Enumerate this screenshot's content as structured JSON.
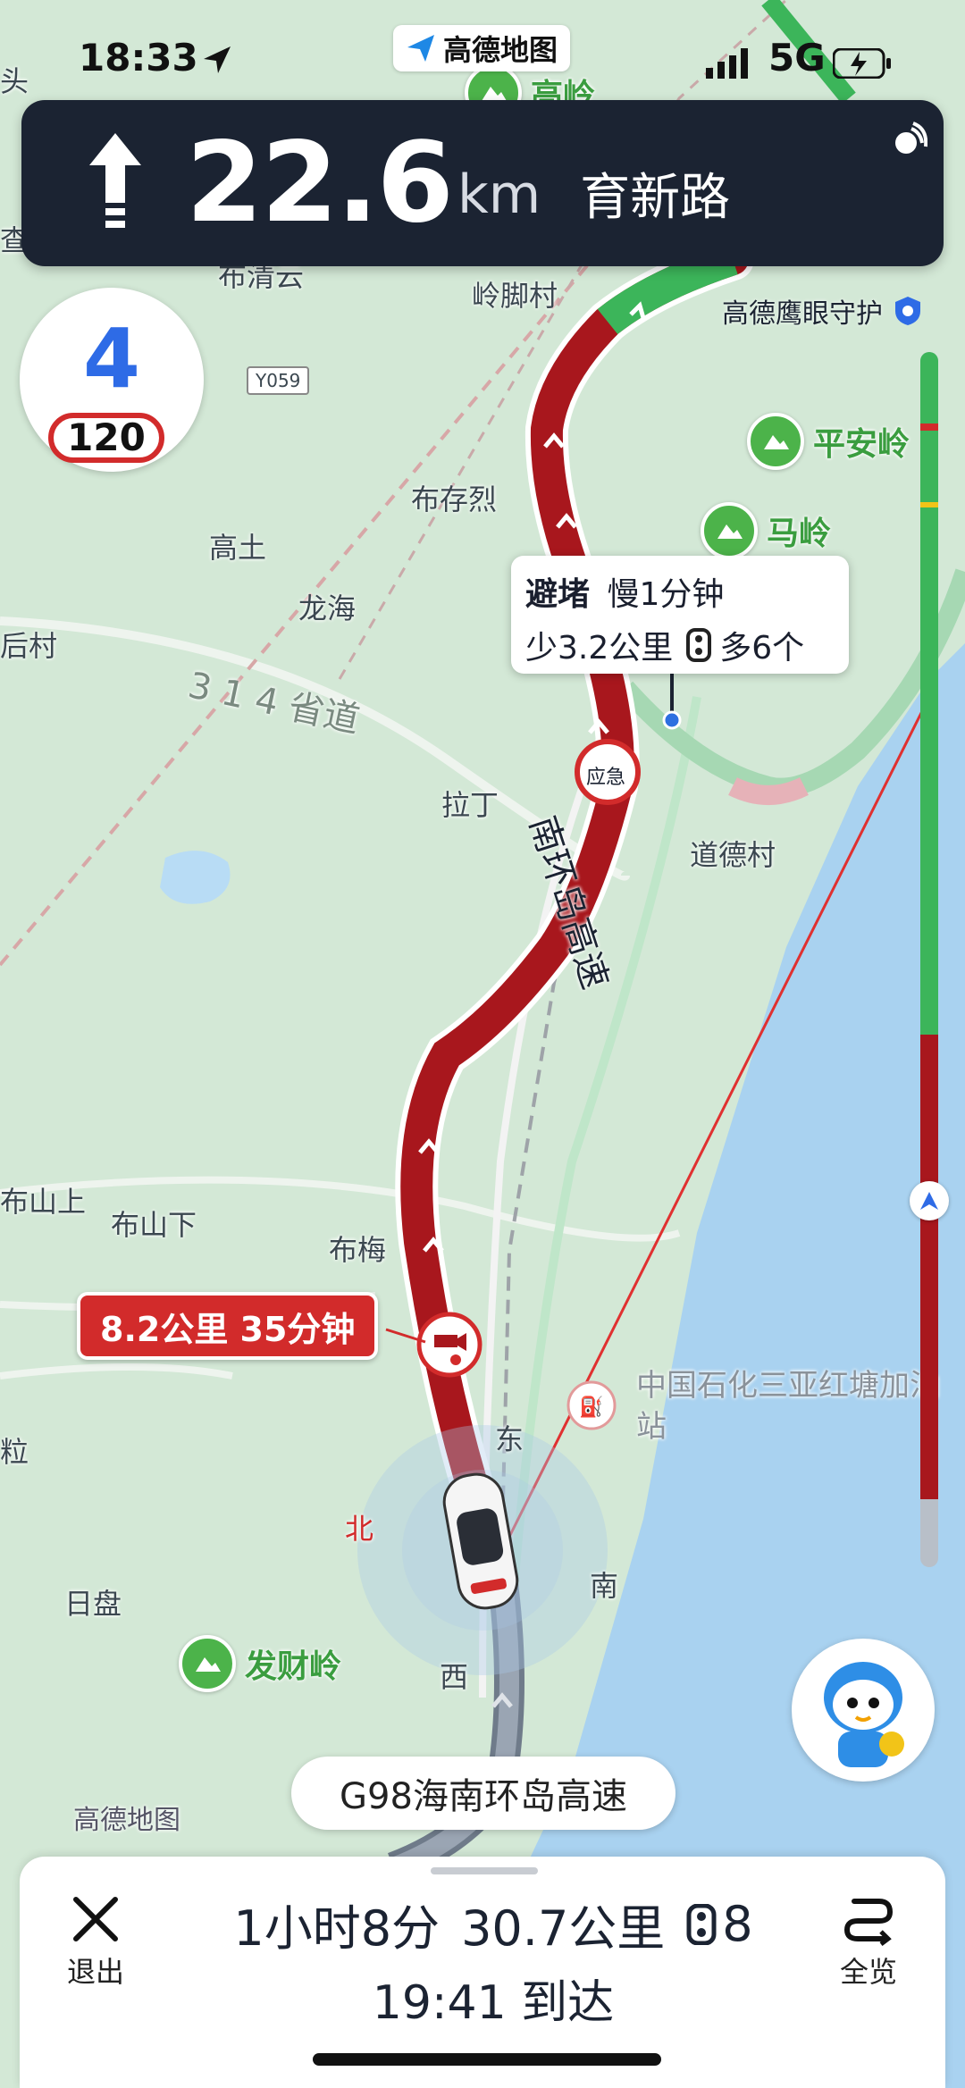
{
  "status_bar": {
    "time": "18:33",
    "network": "5G",
    "app_badge": "高德地图"
  },
  "banner": {
    "distance": "22.6",
    "unit": "km",
    "road": "育新路"
  },
  "lane": {
    "number": "4",
    "speed_limit": "120"
  },
  "eagle_eye": "高德鹰眼守护",
  "map_labels": {
    "gaoling": "高岭",
    "lingjiaocun": "岭脚村",
    "buqingyun": "布清云",
    "y059": "Y059",
    "bucunlie": "布存烈",
    "gaotu": "高土",
    "longhai": "龙海",
    "houcun": "后村",
    "sheng314": "3 1 4 省道",
    "lading": "拉丁",
    "daodecun": "道德村",
    "highway": "南环岛高速",
    "bushanshang": "布山上",
    "bushanxia": "布山下",
    "bumei": "布梅",
    "rili": "日盘",
    "dong": "东",
    "nan": "南",
    "xi": "西",
    "bei": "北",
    "fali": "粒",
    "tou": "头",
    "cha": "查",
    "gas_station": "中国石化三亚红塘加油站",
    "yingji": "应急",
    "brand_watermark": "高德地图",
    "hou": "后"
  },
  "pois": {
    "pinganling": "平安岭",
    "maling": "马岭",
    "facailing": "发财岭"
  },
  "tooltip": {
    "title": "避堵",
    "slower": "慢1分钟",
    "shorter": "少3.2公里",
    "more_lights": "多6个"
  },
  "segment_pill": "8.2公里 35分钟",
  "road_chip": "G98海南环岛高速",
  "bottom": {
    "exit_label": "退出",
    "duration": "1小时8分",
    "distance": "30.7公里",
    "lights": "8",
    "arrival": "19:41 到达",
    "overview_label": "全览"
  },
  "colors": {
    "congested": "#a8171d",
    "clear": "#3cb55a",
    "banner": "#1b2332",
    "water": "#a9d2f0"
  }
}
